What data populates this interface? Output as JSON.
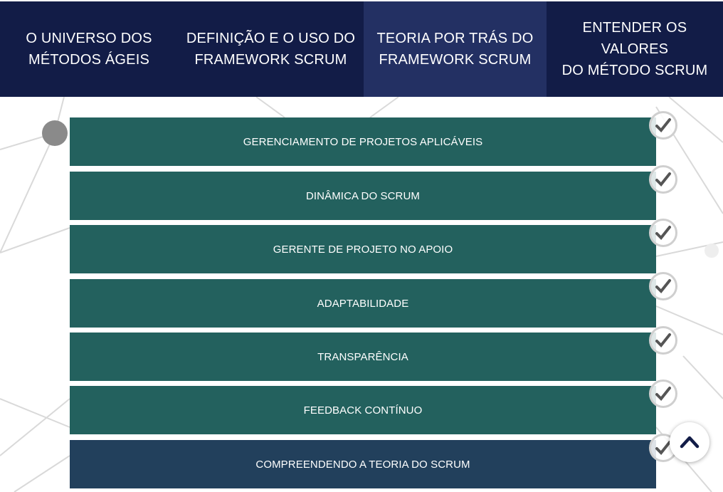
{
  "nav": {
    "tabs": [
      {
        "label": "O UNIVERSO DOS\nMÉTODOS ÁGEIS",
        "active": false
      },
      {
        "label": "DEFINIÇÃO E O USO DO\nFRAMEWORK SCRUM",
        "active": false
      },
      {
        "label": "TEORIA POR TRÁS DO\nFRAMEWORK SCRUM",
        "active": true
      },
      {
        "label": "ENTENDER OS VALORES\nDO MÉTODO SCRUM",
        "active": false
      }
    ]
  },
  "topics": [
    {
      "label": "GERENCIAMENTO DE PROJETOS APLICÁVEIS",
      "completed": true
    },
    {
      "label": "DINÂMICA DO SCRUM",
      "completed": true
    },
    {
      "label": "GERENTE DE PROJETO NO APOIO",
      "completed": true
    },
    {
      "label": "ADAPTABILIDADE",
      "completed": true
    },
    {
      "label": "TRANSPARÊNCIA",
      "completed": true
    },
    {
      "label": "FEEDBACK CONTÍNUO",
      "completed": true
    },
    {
      "label": "COMPREENDENDO A TEORIA DO SCRUM",
      "completed": true
    }
  ],
  "icons": {
    "check": "checkmark-icon",
    "scroll_top": "chevron-up-icon"
  },
  "colors": {
    "nav_background": "#121c47",
    "nav_active": "#233063",
    "topic_background": "#23615e",
    "topic_last_background": "#22405c",
    "check_mark": "#555555",
    "chevron": "#121c47"
  }
}
